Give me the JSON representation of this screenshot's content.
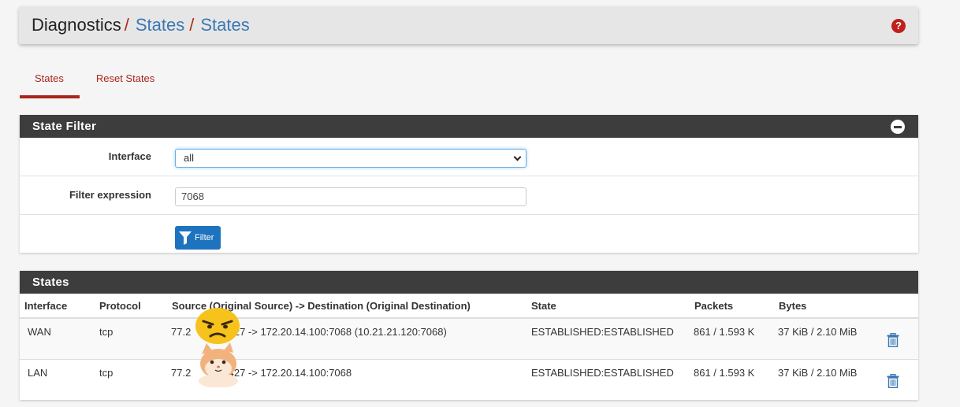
{
  "breadcrumb": {
    "root": "Diagnostics",
    "sep1": "/",
    "link1": "States",
    "sep2": "/",
    "link2": "States",
    "help_icon": "question-circle-icon"
  },
  "tabs": [
    {
      "label": "States",
      "active": true
    },
    {
      "label": "Reset States",
      "active": false
    }
  ],
  "state_filter": {
    "heading": "State Filter",
    "interface_label": "Interface",
    "interface_value": "all",
    "filter_expression_label": "Filter expression",
    "filter_expression_value": "7068",
    "filter_button": "Filter"
  },
  "states": {
    "heading": "States",
    "columns": [
      "Interface",
      "Protocol",
      "Source (Original Source) -> Destination (Original Destination)",
      "State",
      "Packets",
      "Bytes"
    ],
    "rows": [
      {
        "interface": "WAN",
        "protocol": "tcp",
        "source_prefix": "77.2",
        "source_rest": "2:59427 -> 172.20.14.100:7068 (10.21.21.120:7068)",
        "state": "ESTABLISHED:ESTABLISHED",
        "packets": "861 / 1.593 K",
        "bytes": "37 KiB / 2.10 MiB"
      },
      {
        "interface": "LAN",
        "protocol": "tcp",
        "source_prefix": "77.2",
        "source_rest": "2:59427 -> 172.20.14.100:7068",
        "state": "ESTABLISHED:ESTABLISHED",
        "packets": "861 / 1.593 K",
        "bytes": "37 KiB / 2.10 MiB"
      }
    ]
  },
  "colors": {
    "accent_red": "#a8261c",
    "link_blue": "#3a78b5",
    "panel_dark": "#3d3d3d",
    "button_blue": "#1e73be"
  }
}
